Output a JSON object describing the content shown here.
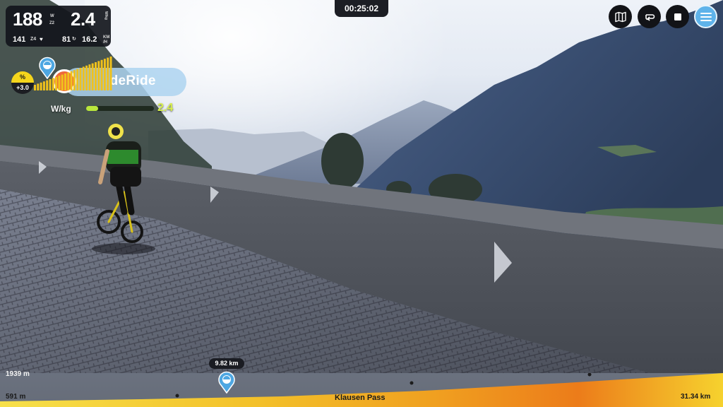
{
  "stats": {
    "power": "188",
    "power_unit_top": "W",
    "power_zone": "Z2",
    "wkg": "2.4",
    "wkg_unit": "W/kg",
    "heart_rate": "141",
    "hr_zone": "Z4",
    "cadence": "81",
    "speed": "16.2",
    "speed_unit_top": "KM",
    "speed_unit_bottom": "/H"
  },
  "timer": "00:25:02",
  "toolbar": {
    "map_icon": "map-icon",
    "loop_icon": "loop-icon",
    "stop_icon": "stop-icon",
    "menu_icon": "hamburger-menu-icon",
    "accent": "#5fb3ea"
  },
  "gradient": {
    "label": "%",
    "value": "+3.0",
    "color": "#f5d51c"
  },
  "brand": {
    "name": "ideRide"
  },
  "power_meter": {
    "label": "W/kg",
    "value": "2.4",
    "fill_fraction": 0.18,
    "color": "#b9e63c"
  },
  "route": {
    "max_elevation": "1939 m",
    "min_elevation": "591 m",
    "name": "Klausen Pass",
    "total_distance": "31.34 km",
    "current_distance": "9.82 km",
    "progress_fraction": 0.313
  }
}
